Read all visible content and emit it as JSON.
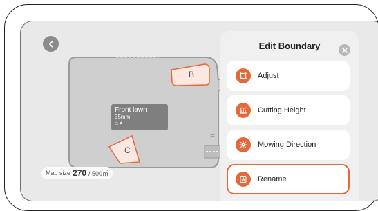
{
  "panel": {
    "title": "Edit Boundary",
    "items": [
      {
        "label": "Adjust",
        "icon": "adjust-icon"
      },
      {
        "label": "Cutting Height",
        "icon": "cutting-height-icon"
      },
      {
        "label": "Mowing Direction",
        "icon": "mowing-direction-icon"
      },
      {
        "label": "Rename",
        "icon": "rename-icon",
        "selected": true
      }
    ]
  },
  "map": {
    "lawn_name": "Front lawn",
    "lawn_height": "35mm",
    "lawn_icons": "⌂ ≠",
    "zone_b": "B",
    "zone_c": "C",
    "zone_e": "E",
    "map_size_label": "Map size",
    "map_size_value": "270",
    "map_size_total": "/ 500㎡"
  },
  "colors": {
    "accent": "#e4683a",
    "zone_fill": "#fbe9e1",
    "map_bg": "#e9e9e9",
    "lawn_fill": "#cfcfcf"
  }
}
